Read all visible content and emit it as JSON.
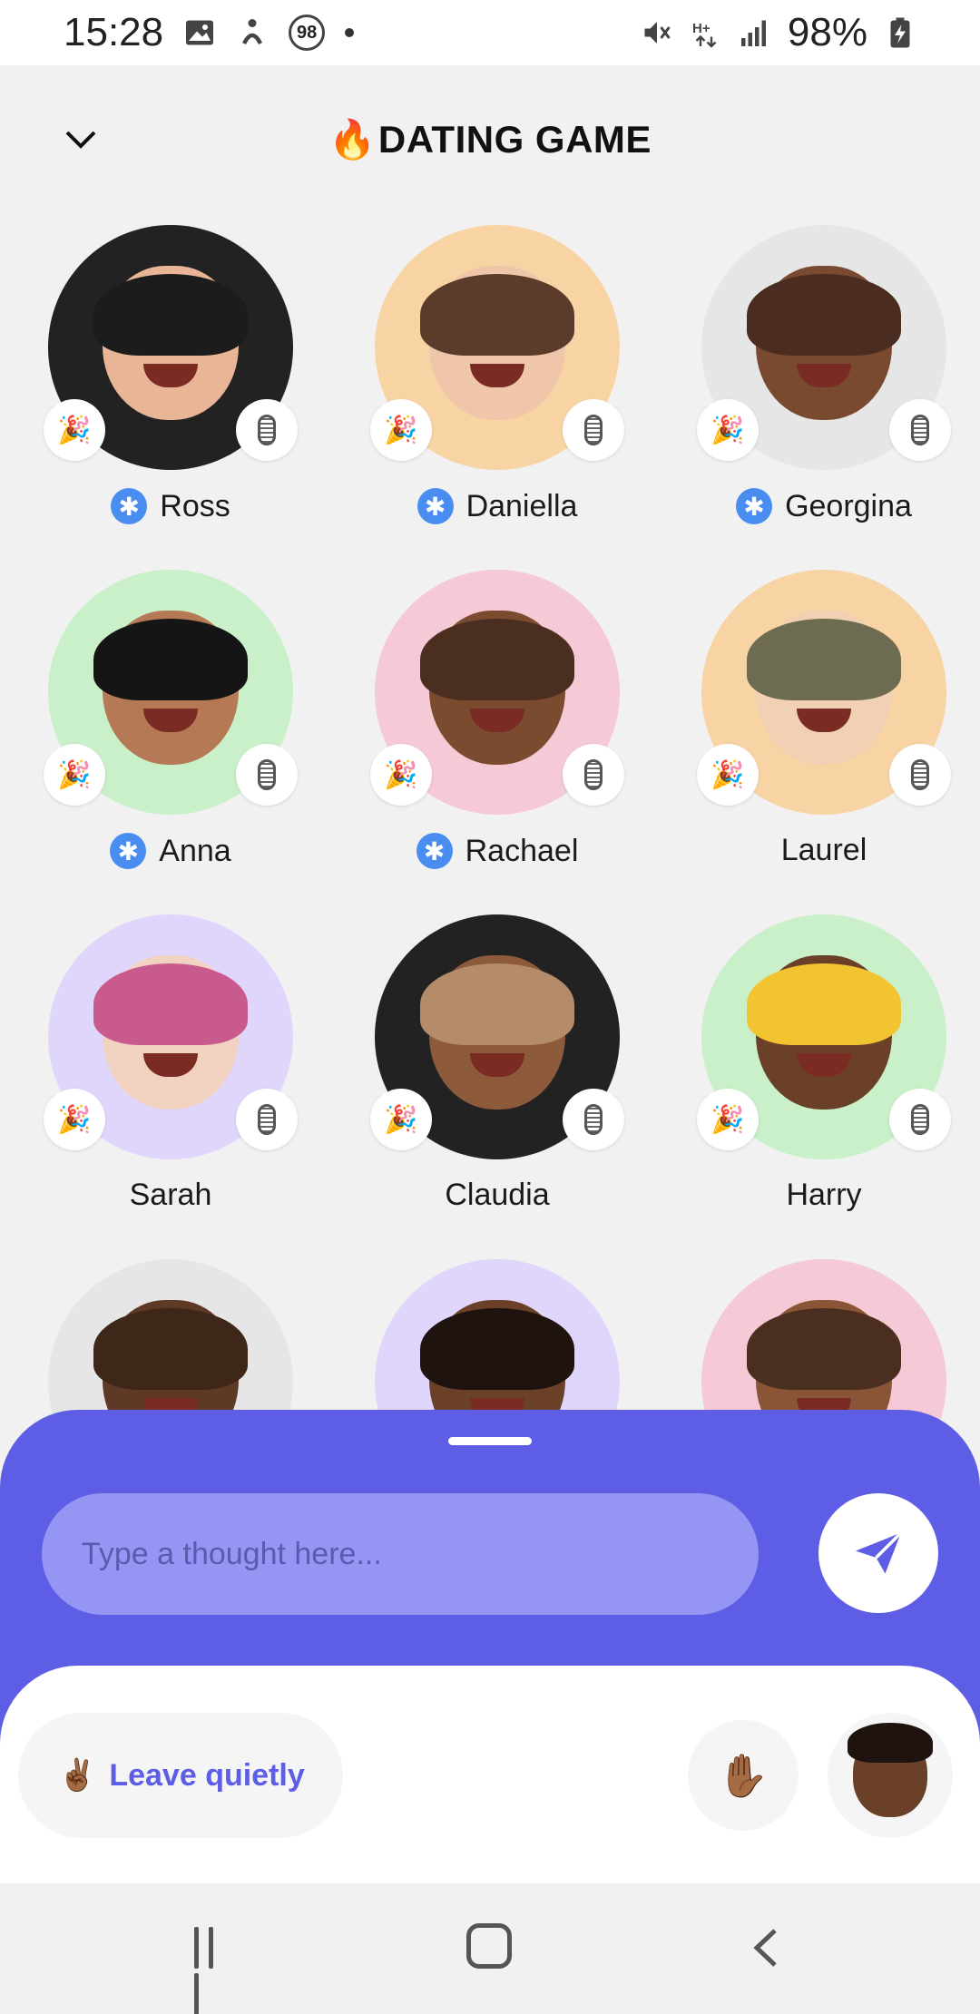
{
  "status_bar": {
    "time": "15:28",
    "notif_badge": "98",
    "battery": "98%"
  },
  "header": {
    "title": "DATING GAME",
    "title_emoji": "🔥"
  },
  "participants": [
    {
      "name": "Ross",
      "verified": true,
      "bg": "#222222",
      "skin": "#e8b696",
      "hair": "#1c1c1c"
    },
    {
      "name": "Daniella",
      "verified": true,
      "bg": "#f8d4a5",
      "skin": "#efc6a9",
      "hair": "#5b3b2a"
    },
    {
      "name": "Georgina",
      "verified": true,
      "bg": "#e6e6e6",
      "skin": "#7a4a30",
      "hair": "#4a2d20"
    },
    {
      "name": "Anna",
      "verified": true,
      "bg": "#c9f0c8",
      "skin": "#b57a55",
      "hair": "#151515"
    },
    {
      "name": "Rachael",
      "verified": true,
      "bg": "#f5c9d6",
      "skin": "#7b4b2f",
      "hair": "#4a2e20"
    },
    {
      "name": "Laurel",
      "verified": false,
      "bg": "#f8d4a5",
      "skin": "#f1d0b4",
      "hair": "#6d6b50"
    },
    {
      "name": "Sarah",
      "verified": false,
      "bg": "#e0d6fb",
      "skin": "#f2d2c0",
      "hair": "#c85a8e"
    },
    {
      "name": "Claudia",
      "verified": false,
      "bg": "#222222",
      "skin": "#8d5a3b",
      "hair": "#b48c6a"
    },
    {
      "name": "Harry",
      "verified": false,
      "bg": "#c9f0c8",
      "skin": "#6a4029",
      "hair": "#f3c432"
    },
    {
      "name": "",
      "verified": false,
      "bg": "#e6e6e6",
      "skin": "#5e3a26",
      "hair": "#3e2618"
    },
    {
      "name": "",
      "verified": false,
      "bg": "#e0d6fb",
      "skin": "#6a4029",
      "hair": "#1e130e"
    },
    {
      "name": "",
      "verified": false,
      "bg": "#f5c9d6",
      "skin": "#8a5536",
      "hair": "#4a2e20"
    }
  ],
  "composer": {
    "placeholder": "Type a thought here..."
  },
  "actions": {
    "leave_label": "Leave quietly",
    "leave_emoji": "✌🏾",
    "raise_hand_emoji": "✋🏾"
  },
  "colors": {
    "accent": "#5d5de6",
    "input_bg": "#9595f3"
  },
  "icons": {
    "confetti": "🎉",
    "verified": "✱"
  }
}
